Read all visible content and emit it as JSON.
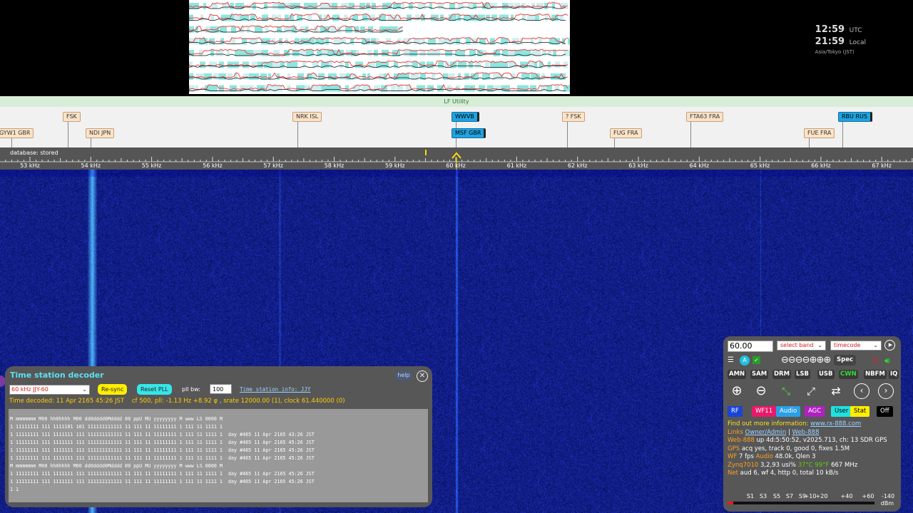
{
  "clock": {
    "utc_time": "12:59",
    "utc_label": "UTC",
    "local_time": "21:59",
    "local_label": "Local",
    "timezone": "Asia/Tokyo (JST)"
  },
  "band": {
    "name": "LF Utility"
  },
  "stations": [
    {
      "label": "GYW1 GBR",
      "row": 2,
      "selected": false
    },
    {
      "label": "FSK",
      "row": 1,
      "selected": false
    },
    {
      "label": "NDI JPN",
      "row": 2,
      "selected": false
    },
    {
      "label": "NRK ISL",
      "row": 1,
      "selected": false
    },
    {
      "label": "WWVB",
      "row": 1,
      "selected": true
    },
    {
      "label": "MSF GBR",
      "row": 2,
      "selected": true
    },
    {
      "label": "? FSK",
      "row": 1,
      "selected": false
    },
    {
      "label": "FUG FRA",
      "row": 2,
      "selected": false
    },
    {
      "label": "FTA63 FRA",
      "row": 1,
      "selected": false
    },
    {
      "label": "FUE FRA",
      "row": 2,
      "selected": false
    },
    {
      "label": "RBU RUS",
      "row": 1,
      "selected": true
    }
  ],
  "scale": {
    "database_label": "database: stored",
    "freq_labels": [
      "53 kHz",
      "54 kHz",
      "55 kHz",
      "56 kHz",
      "57 kHz",
      "58 kHz",
      "59 kHz",
      "60 kHz",
      "61 kHz",
      "62 kHz",
      "63 kHz",
      "64 kHz",
      "65 kHz",
      "66 kHz",
      "67 kHz"
    ]
  },
  "decoder": {
    "title": "Time station decoder",
    "help_label": "help",
    "close_icon": "⊗",
    "station_select": "60 kHz JJY-60",
    "resync_label": "Re-sync",
    "reset_pll_label": "Reset PLL",
    "pll_bw_label": "pll bw:",
    "pll_bw_value": "100",
    "info_link": "Time station info: JJY",
    "status_decoded": "Time decoded: 11 Apr 2165 45:26 JST",
    "status_pll": "cf 500, pll: -1.13 Hz +8.92 φ , srate 12000.00 (1), clock 61.440000 (0)",
    "log_lines": [
      "M mmmmmmm M00 hh0hhhh M00 dd0dddd0Mdddd 00 ppU MU yyyyyyyy M www LS 0000 M",
      "1 11111111 111 1111101 101 111111111111 11 111 11 11111111 1 111 11 1111 1",
      "1 11111111 111 1111111 111 111111111111 11 111 11 11111111 1 111 11 1111 1  day #465 11 Apr 2165 43:26 JST",
      "1 11111111 111 1111111 111 111111111111 11 111 11 11111111 1 111 11 1111 1  day #465 11 Apr 2165 45:26 JST",
      "1 11111111 111 1111111 111 111111111111 11 111 11 11111111 1 111 11 1111 1  day #465 11 Apr 2165 45:26 JST",
      "1 11111111 111 1111111 111 111111111111 11 111 11 11111111 1 111 11 1111 1  day #465 11 Apr 2165 45:26 JST",
      "M mmmmmmm M00 hh0hhhh M00 dd0dddd0Mdddd 00 ppU MU yyyyyyyy M www LS 0000 M",
      "1 11111111 111 1111111 111 111111111111 11 111 11 11111111 1 111 11 1111 1  day #465 11 Apr 2165 45:26 JST",
      "1 11111111 111 1111111 111 111111111111 11 111 11 11111111 1 111 11 1111 1  day #465 11 Apr 2165 45:26 JST",
      "1 1"
    ]
  },
  "control": {
    "freq_value": "60.00",
    "band_select": "select band",
    "ext_select": "timecode",
    "spec_label": "Spec",
    "modes": [
      "AMN",
      "SAM",
      "DRM",
      "LSB",
      "USB",
      "CWN",
      "NBFM",
      "IQ"
    ],
    "active_mode": "CWN",
    "tabs": [
      {
        "label": "RF",
        "bg": "#1a44d8",
        "fg": "#ffffff"
      },
      {
        "label": "WF11",
        "bg": "#e8186a",
        "fg": "#ffffff"
      },
      {
        "label": "Audio",
        "bg": "#2aa0e8",
        "fg": "#ffffff"
      },
      {
        "label": "AGC",
        "bg": "#b020c0",
        "fg": "#ffffff"
      },
      {
        "label": "User",
        "bg": "#20e0e0",
        "fg": "#000000"
      },
      {
        "label": "Stat",
        "bg": "#ffee00",
        "fg": "#000000"
      },
      {
        "label": "Off",
        "bg": "#000000",
        "fg": "#ffffff"
      }
    ],
    "info": {
      "find_out": "Find out more information:",
      "find_link": "www.rx-888.com",
      "links_label": "Links",
      "owner_link": "Owner/Admin",
      "sep": "|",
      "web_link": "Web-888",
      "web_label": "Web-888",
      "web_text": "up 4d:5:50:52, v2025.713, ch: 13 SDR GPS",
      "gps_label": "GPS",
      "gps_text": "acq yes, track 0, good 0, fixes 1.5M",
      "wf_label": "WF",
      "wf_text": "7 fps",
      "audio_label": "Audio",
      "audio_text": "48.0k, Qlen 3",
      "zynq_label": "Zynq7010",
      "zynq_text": "3,2,93 usi%",
      "temp_text": "37°C 99°F",
      "mhz_text": "667 MHz",
      "net_label": "Net",
      "net_text": "aud 6, wf 4, http 0, total 10 kB/s"
    },
    "smeter": {
      "labels": [
        "S1",
        "S3",
        "S5",
        "S7",
        "S9",
        "+10",
        "+20",
        "+40",
        "+60",
        "-140"
      ],
      "unit": "dBm",
      "level_fraction": 0.04
    }
  }
}
